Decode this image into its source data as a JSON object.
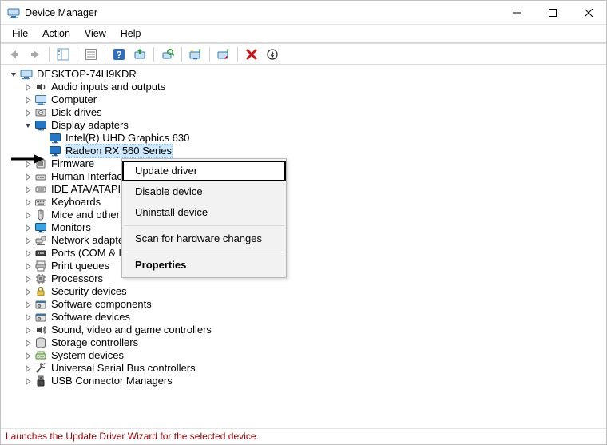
{
  "title": "Device Manager",
  "menu": {
    "file": "File",
    "action": "Action",
    "view": "View",
    "help": "Help"
  },
  "toolbar": {
    "back": "back-icon",
    "forward": "forward-icon",
    "show_hide": "show-hide-tree-icon",
    "props": "properties-icon",
    "help": "help-icon",
    "update": "update-driver-icon",
    "scan": "scan-hardware-icon",
    "add_legacy": "add-hardware-icon",
    "disable": "disable-device-icon",
    "uninstall": "uninstall-device-icon",
    "more": "more-actions-icon"
  },
  "tree": {
    "root": "DESKTOP-74H9KDR",
    "categories": [
      {
        "label": "Audio inputs and outputs",
        "icon": "audio-icon",
        "expanded": false
      },
      {
        "label": "Computer",
        "icon": "computer-icon",
        "expanded": false
      },
      {
        "label": "Disk drives",
        "icon": "disk-icon",
        "expanded": false
      },
      {
        "label": "Display adapters",
        "icon": "display-icon",
        "expanded": true,
        "children": [
          {
            "label": "Intel(R) UHD Graphics 630",
            "icon": "display-icon"
          },
          {
            "label": "Radeon RX 560 Series",
            "icon": "display-icon",
            "selected": true
          }
        ]
      },
      {
        "label": "Firmware",
        "icon": "firmware-icon",
        "expanded": false
      },
      {
        "label": "Human Interface Devices",
        "icon": "hid-icon",
        "expanded": false
      },
      {
        "label": "IDE ATA/ATAPI controllers",
        "icon": "ide-icon",
        "expanded": false
      },
      {
        "label": "Keyboards",
        "icon": "keyboard-icon",
        "expanded": false
      },
      {
        "label": "Mice and other pointing devices",
        "icon": "mouse-icon",
        "expanded": false
      },
      {
        "label": "Monitors",
        "icon": "monitor-icon",
        "expanded": false
      },
      {
        "label": "Network adapters",
        "icon": "network-icon",
        "expanded": false
      },
      {
        "label": "Ports (COM & LPT)",
        "icon": "port-icon",
        "expanded": false
      },
      {
        "label": "Print queues",
        "icon": "printer-icon",
        "expanded": false
      },
      {
        "label": "Processors",
        "icon": "cpu-icon",
        "expanded": false
      },
      {
        "label": "Security devices",
        "icon": "security-icon",
        "expanded": false
      },
      {
        "label": "Software components",
        "icon": "software-icon",
        "expanded": false
      },
      {
        "label": "Software devices",
        "icon": "software-icon",
        "expanded": false
      },
      {
        "label": "Sound, video and game controllers",
        "icon": "sound-icon",
        "expanded": false
      },
      {
        "label": "Storage controllers",
        "icon": "storage-icon",
        "expanded": false
      },
      {
        "label": "System devices",
        "icon": "system-icon",
        "expanded": false
      },
      {
        "label": "Universal Serial Bus controllers",
        "icon": "usb-icon",
        "expanded": false
      },
      {
        "label": "USB Connector Managers",
        "icon": "usb-connector-icon",
        "expanded": false
      }
    ]
  },
  "context_menu": {
    "update_driver": "Update driver",
    "disable_device": "Disable device",
    "uninstall_device": "Uninstall device",
    "scan_hardware": "Scan for hardware changes",
    "properties": "Properties"
  },
  "status": "Launches the Update Driver Wizard for the selected device."
}
